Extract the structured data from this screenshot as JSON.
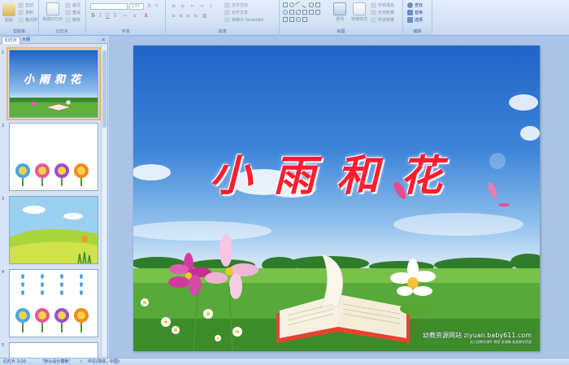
{
  "ribbon": {
    "clipboard": {
      "paste": "粘贴",
      "cut": "剪切",
      "copy": "复制",
      "format_painter": "格式刷",
      "label": "剪贴板"
    },
    "slides": {
      "new_slide": "新建幻灯片",
      "layout": "版式",
      "reset": "重设",
      "delete": "删除",
      "label": "幻灯片"
    },
    "font": {
      "font_name": "",
      "font_size": "130",
      "label": "字体"
    },
    "paragraph": {
      "text_direction": "文字方向",
      "align_text": "对齐文本",
      "convert_smartart": "转换为 SmartArt",
      "label": "段落"
    },
    "drawing": {
      "arrange": "排列",
      "quick_styles": "快速样式",
      "shape_fill": "形状填充",
      "shape_outline": "形状轮廓",
      "shape_effects": "形状效果",
      "label": "绘图"
    },
    "editing": {
      "find": "查找",
      "replace": "替换",
      "select": "选择",
      "label": "编辑"
    }
  },
  "panel": {
    "tabs": [
      "幻灯片",
      "大纲"
    ],
    "close": "×",
    "slide_numbers": [
      "1",
      "2",
      "3",
      "4",
      "5"
    ]
  },
  "slide": {
    "title": "小雨和花",
    "watermark_main": "幼教资源网站  ziyuan.baby611.com",
    "watermark_sub": "幼儿园教学课件 教案 说课稿 各类教学资源"
  },
  "status": {
    "slide_count": "幻灯片 1/10",
    "theme": "\"默认设计模板\"",
    "language": "中文(简体，中国)"
  },
  "colors": {
    "title_red": "#ff1d2f",
    "selection_outline": "#f7b64d",
    "ribbon_text": "#15428b"
  }
}
